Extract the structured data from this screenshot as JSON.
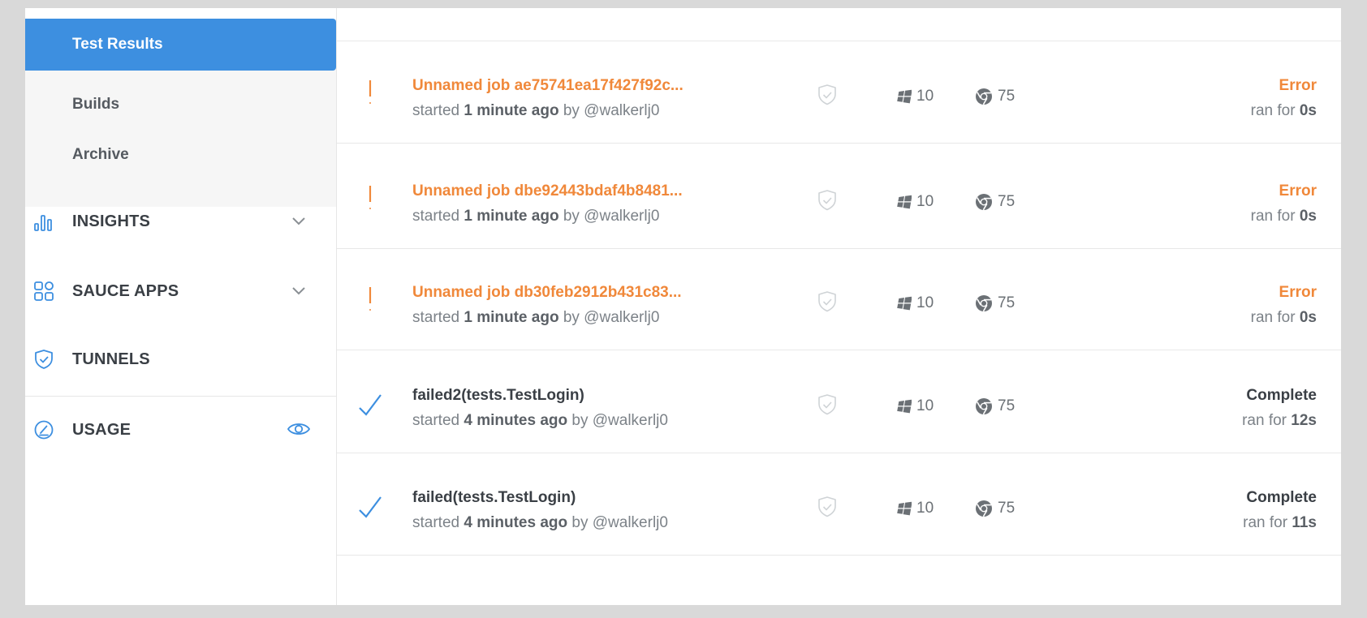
{
  "sidebar": {
    "subnav": [
      {
        "label": "Test Results",
        "active": true
      },
      {
        "label": "Builds",
        "active": false
      },
      {
        "label": "Archive",
        "active": false
      }
    ],
    "nav": [
      {
        "label": "INSIGHTS",
        "icon": "bar-chart-icon",
        "expandable": true
      },
      {
        "label": "SAUCE APPS",
        "icon": "apps-grid-icon",
        "expandable": true
      },
      {
        "label": "TUNNELS",
        "icon": "shield-icon",
        "expandable": false
      },
      {
        "label": "USAGE",
        "icon": "gauge-icon",
        "visibility_toggle": true
      }
    ]
  },
  "jobs": [
    {
      "name": "Unnamed job ae75741ea17f427f92c...",
      "status_type": "error",
      "started_prefix": "started ",
      "started": "1 minute ago",
      "by": " by @walkerlj0",
      "os_version": "10",
      "browser_version": "75",
      "status": "Error",
      "ran_prefix": "ran for ",
      "duration": "0s"
    },
    {
      "name": "Unnamed job dbe92443bdaf4b8481...",
      "status_type": "error",
      "started_prefix": "started ",
      "started": "1 minute ago",
      "by": " by @walkerlj0",
      "os_version": "10",
      "browser_version": "75",
      "status": "Error",
      "ran_prefix": "ran for ",
      "duration": "0s"
    },
    {
      "name": "Unnamed job db30feb2912b431c83...",
      "status_type": "error",
      "started_prefix": "started ",
      "started": "1 minute ago",
      "by": " by @walkerlj0",
      "os_version": "10",
      "browser_version": "75",
      "status": "Error",
      "ran_prefix": "ran for ",
      "duration": "0s"
    },
    {
      "name": "failed2(tests.TestLogin)",
      "status_type": "ok",
      "started_prefix": "started ",
      "started": "4 minutes ago",
      "by": " by @walkerlj0",
      "os_version": "10",
      "browser_version": "75",
      "status": "Complete",
      "ran_prefix": "ran for ",
      "duration": "12s"
    },
    {
      "name": "failed(tests.TestLogin)",
      "status_type": "ok",
      "started_prefix": "started ",
      "started": "4 minutes ago",
      "by": " by @walkerlj0",
      "os_version": "10",
      "browser_version": "75",
      "status": "Complete",
      "ran_prefix": "ran for ",
      "duration": "11s"
    }
  ],
  "colors": {
    "accent": "#3d8fe0",
    "error": "#f0883a",
    "text_dark": "#3a3f45",
    "text_muted": "#7c8288"
  }
}
